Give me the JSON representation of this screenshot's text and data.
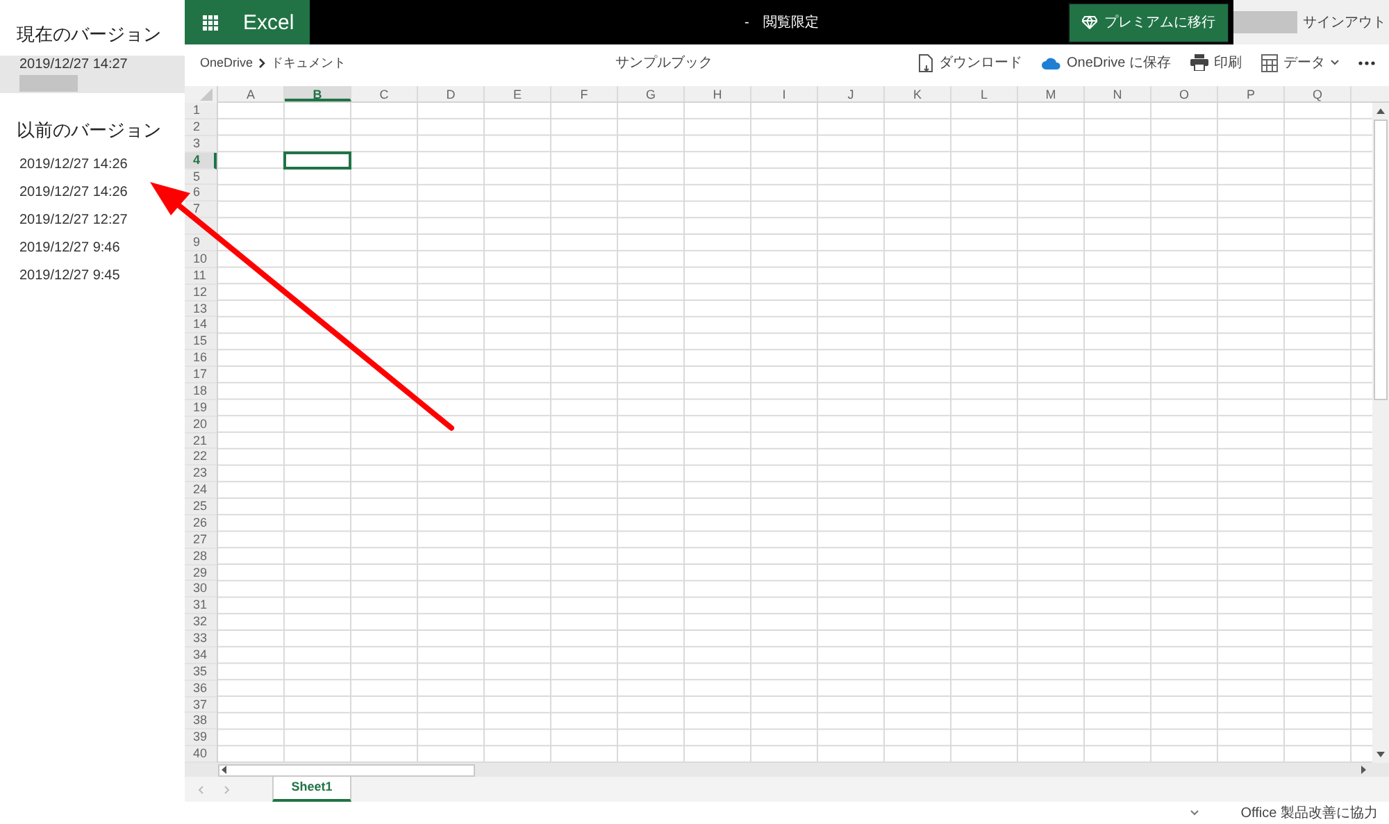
{
  "version_panel": {
    "current_heading": "現在のバージョン",
    "current": {
      "date": "2019/12/27 14:27",
      "selected": true
    },
    "previous_heading": "以前のバージョン",
    "previous": [
      {
        "date": "2019/12/27 14:26",
        "selected": false
      },
      {
        "date": "2019/12/27 14:26",
        "selected": false
      },
      {
        "date": "2019/12/27 12:27",
        "selected": false
      },
      {
        "date": "2019/12/27 9:46",
        "selected": false
      },
      {
        "date": "2019/12/27 9:45",
        "selected": false
      }
    ]
  },
  "app_bar": {
    "app_name": "Excel",
    "document_status": "-　閲覧限定",
    "premium_button": "プレミアムに移行",
    "sign_out": "サインアウト"
  },
  "toolbar": {
    "breadcrumb": [
      "OneDrive",
      "ドキュメント"
    ],
    "file_name": "サンプルブック",
    "actions": [
      {
        "kind": "download",
        "label": "ダウンロード"
      },
      {
        "kind": "onedrive",
        "label": "OneDrive に保存"
      },
      {
        "kind": "print",
        "label": "印刷"
      },
      {
        "kind": "data",
        "label": "データ"
      },
      {
        "kind": "more"
      }
    ]
  },
  "sheet": {
    "columns": [
      {
        "label": "A",
        "selected": false
      },
      {
        "label": "B",
        "selected": true
      },
      {
        "label": "C",
        "selected": false
      },
      {
        "label": "D",
        "selected": false
      },
      {
        "label": "E",
        "selected": false
      },
      {
        "label": "F",
        "selected": false
      },
      {
        "label": "G",
        "selected": false
      },
      {
        "label": "H",
        "selected": false
      },
      {
        "label": "I",
        "selected": false
      },
      {
        "label": "J",
        "selected": false
      },
      {
        "label": "K",
        "selected": false
      },
      {
        "label": "L",
        "selected": false
      },
      {
        "label": "M",
        "selected": false
      },
      {
        "label": "N",
        "selected": false
      },
      {
        "label": "O",
        "selected": false
      },
      {
        "label": "P",
        "selected": false
      },
      {
        "label": "Q",
        "selected": false
      }
    ],
    "rows": [
      {
        "label": "1",
        "selected": false
      },
      {
        "label": "2",
        "selected": false
      },
      {
        "label": "3",
        "selected": false
      },
      {
        "label": "4",
        "selected": true
      },
      {
        "label": "5",
        "selected": false
      },
      {
        "label": "6",
        "selected": false
      },
      {
        "label": "7",
        "selected": false
      },
      {
        "selected": false
      },
      {
        "label": "9",
        "selected": false
      },
      {
        "label": "10",
        "selected": false
      },
      {
        "label": "11",
        "selected": false
      },
      {
        "label": "12",
        "selected": false
      },
      {
        "label": "13",
        "selected": false
      },
      {
        "label": "14",
        "selected": false
      },
      {
        "label": "15",
        "selected": false
      },
      {
        "label": "16",
        "selected": false
      },
      {
        "label": "17",
        "selected": false
      },
      {
        "label": "18",
        "selected": false
      },
      {
        "label": "19",
        "selected": false
      },
      {
        "label": "20",
        "selected": false
      },
      {
        "label": "21",
        "selected": false
      },
      {
        "label": "22",
        "selected": false
      },
      {
        "label": "23",
        "selected": false
      },
      {
        "label": "24",
        "selected": false
      },
      {
        "label": "25",
        "selected": false
      },
      {
        "label": "26",
        "selected": false
      },
      {
        "label": "27",
        "selected": false
      },
      {
        "label": "28",
        "selected": false
      },
      {
        "label": "29",
        "selected": false
      },
      {
        "label": "30",
        "selected": false
      },
      {
        "label": "31",
        "selected": false
      },
      {
        "label": "32",
        "selected": false
      },
      {
        "label": "33",
        "selected": false
      },
      {
        "label": "34",
        "selected": false
      },
      {
        "label": "35",
        "selected": false
      },
      {
        "label": "36",
        "selected": false
      },
      {
        "label": "37",
        "selected": false
      },
      {
        "label": "38",
        "selected": false
      },
      {
        "label": "39",
        "selected": false
      },
      {
        "label": "40",
        "selected": false
      }
    ]
  },
  "sheet_tabs": [
    {
      "label": "Sheet1",
      "selected": true
    }
  ],
  "status_bar": {
    "feedback": "Office 製品改善に協力"
  }
}
